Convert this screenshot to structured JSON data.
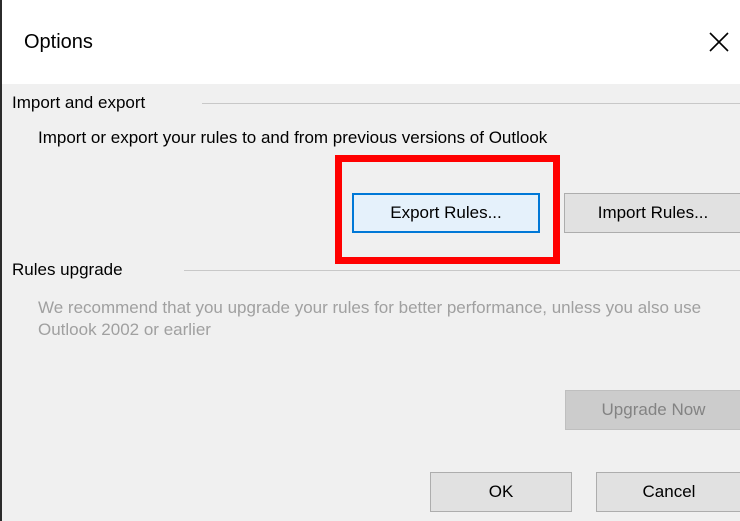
{
  "dialog": {
    "title": "Options",
    "close_label": "Close"
  },
  "import_export": {
    "heading": "Import and export",
    "description": "Import or export your rules to and from previous versions of Outlook",
    "export_label": "Export Rules...",
    "import_label": "Import Rules..."
  },
  "rules_upgrade": {
    "heading": "Rules upgrade",
    "description": "We recommend that you upgrade your rules for better performance, unless you also use Outlook 2002 or earlier",
    "upgrade_label": "Upgrade Now"
  },
  "footer": {
    "ok_label": "OK",
    "cancel_label": "Cancel"
  },
  "highlight": {
    "color": "#ff0000",
    "target": "export-rules-button"
  },
  "colors": {
    "accent": "#0078d7",
    "disabled_text": "#a0a0a0"
  }
}
